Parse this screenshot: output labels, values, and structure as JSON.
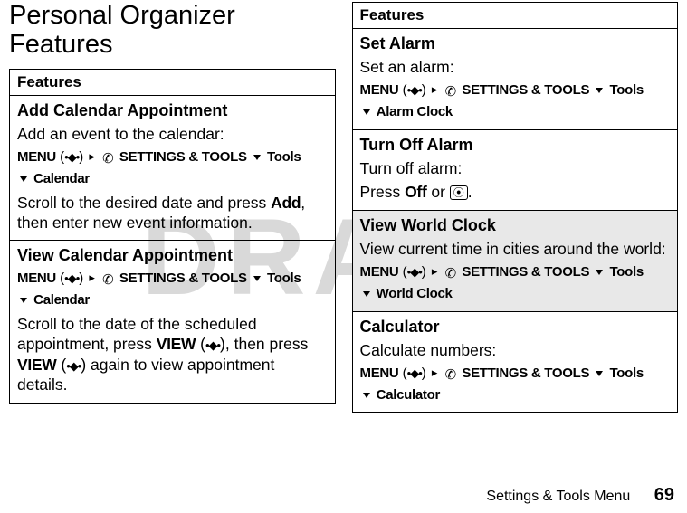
{
  "watermark": "DRAFT",
  "heading": "Personal Organizer Features",
  "features_label": "Features",
  "left": {
    "addcal": {
      "title": "Add Calendar Appointment",
      "desc": "Add an event to the calendar:",
      "path_prefix": "MENU",
      "settings": "SETTINGS & TOOLS",
      "tools": "Tools",
      "sub": "Calendar",
      "after1": "Scroll to the desired date and press ",
      "after1b": "Add",
      "after2": ", then enter new event information."
    },
    "viewcal": {
      "title": "View Calendar Appointment",
      "path_prefix": "MENU",
      "settings": "SETTINGS & TOOLS",
      "tools": "Tools",
      "sub": "Calendar",
      "after1": "Scroll to the date of the scheduled appointment, press ",
      "after1b": "VIEW",
      "mid": ", then press ",
      "after2b": "VIEW",
      "after3": " again to view appointment details."
    }
  },
  "right": {
    "setalarm": {
      "title": "Set Alarm",
      "desc": "Set an alarm:",
      "path_prefix": "MENU",
      "settings": "SETTINGS & TOOLS",
      "tools": "Tools",
      "sub": "Alarm Clock"
    },
    "turnoff": {
      "title": "Turn Off Alarm",
      "desc": "Turn off alarm:",
      "press": "Press ",
      "off": "Off",
      "or": " or ",
      "period": "."
    },
    "world": {
      "title": "View World Clock",
      "desc": "View current time in cities around the world:",
      "path_prefix": "MENU",
      "settings": "SETTINGS & TOOLS",
      "tools": "Tools",
      "sub": "World Clock"
    },
    "calc": {
      "title": "Calculator",
      "desc": "Calculate numbers:",
      "path_prefix": "MENU",
      "settings": "SETTINGS & TOOLS",
      "tools": "Tools",
      "sub": "Calculator"
    }
  },
  "footer": {
    "section": "Settings & Tools Menu",
    "page": "69"
  }
}
